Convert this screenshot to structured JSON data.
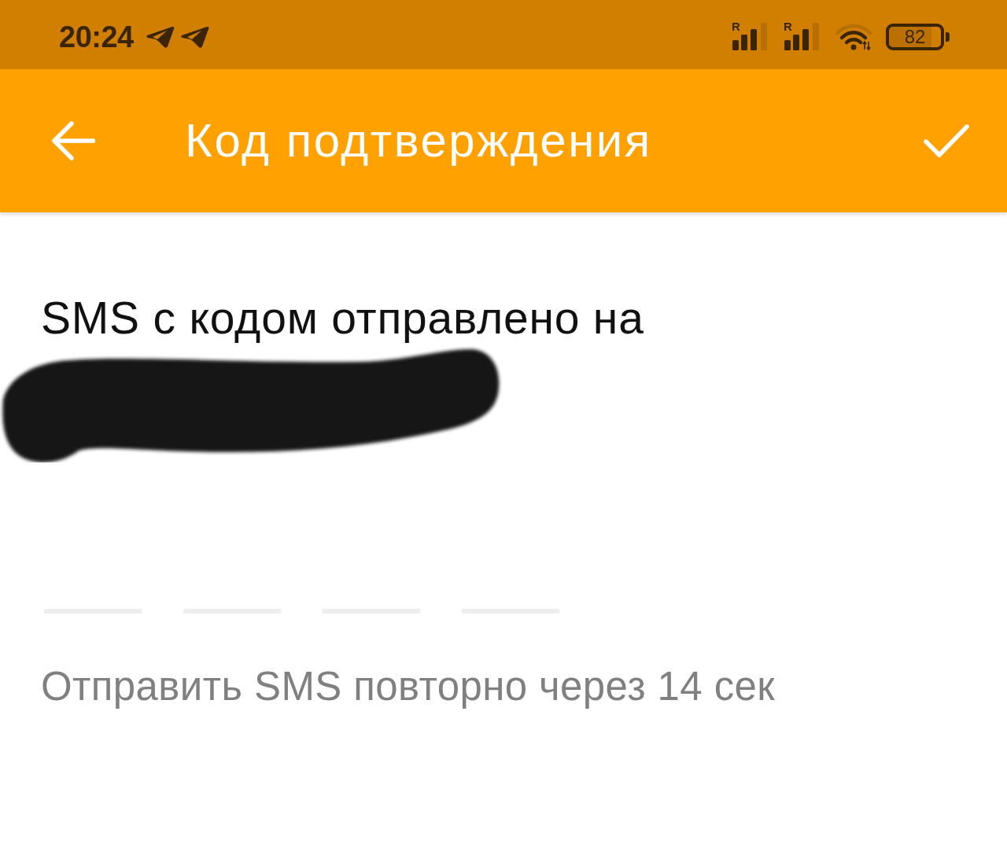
{
  "status_bar": {
    "time": "20:24",
    "notification_icons": [
      {
        "kind": "plane"
      },
      {
        "kind": "plane"
      }
    ],
    "sim_signals": [
      {
        "label": "R"
      },
      {
        "label": "R"
      }
    ],
    "battery": "82"
  },
  "app_bar": {
    "title": "Код подтверждения"
  },
  "message": "SMS с кодом отправлено на",
  "code_fields": [
    {
      "focused": false
    },
    {
      "focused": false
    },
    {
      "focused": false
    },
    {
      "focused": false
    }
  ],
  "resend_text": "Отправить SMS повторно через 14 сек"
}
